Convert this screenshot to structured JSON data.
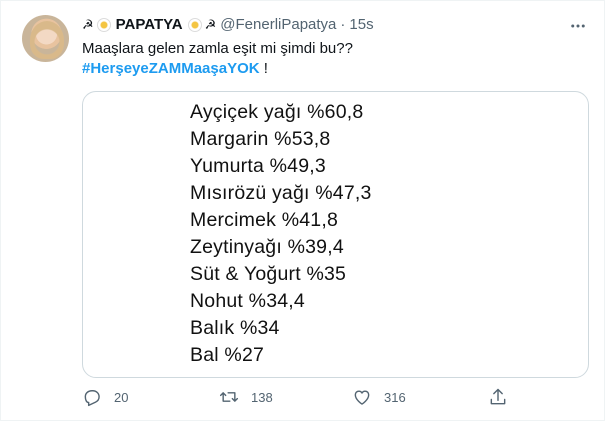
{
  "tweet": {
    "display_name": "PAPATYA",
    "handle": "@FenerliPapatya",
    "separator": "·",
    "time": "15s",
    "text_line1": "Maaşlara gelen zamla eşit mi şimdi bu??",
    "hashtag": "#HerşeyeZAMMaaşaYOK",
    "after_hashtag": " !",
    "name_emoji": "☭"
  },
  "image_list": [
    "Ayçiçek yağı %60,8",
    "Margarin %53,8",
    "Yumurta %49,3",
    "Mısırözü yağı %47,3",
    "Mercimek %41,8",
    "Zeytinyağı %39,4",
    "Süt & Yoğurt %35",
    "Nohut %34,4",
    "Balık %34",
    "Bal %27"
  ],
  "actions": {
    "reply_count": "20",
    "retweet_count": "138",
    "like_count": "316"
  },
  "icons": [
    "more-icon",
    "reply-icon",
    "retweet-icon",
    "like-icon",
    "share-icon"
  ],
  "colors": {
    "link": "#1d9bf0",
    "secondary_text": "#536471",
    "border": "#cfd9de"
  }
}
